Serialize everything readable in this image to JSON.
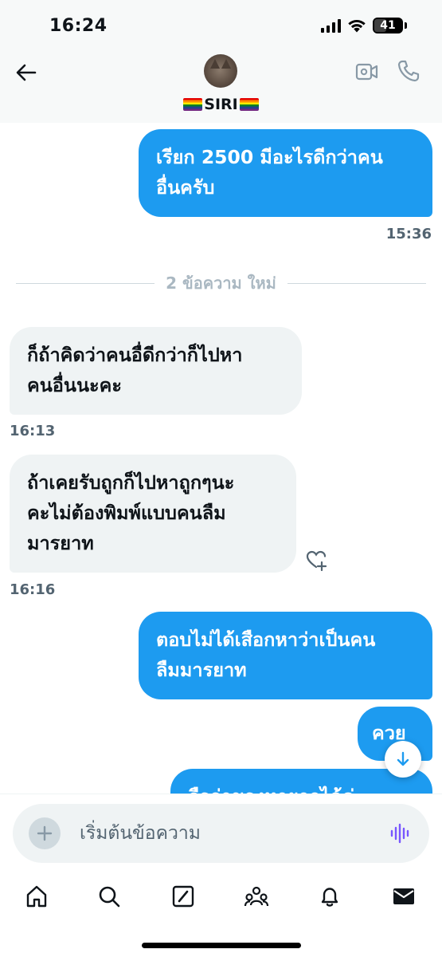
{
  "status_bar": {
    "time": "16:24",
    "battery": "41"
  },
  "header": {
    "contact_name": "SIRI",
    "icons": {
      "back": "arrow-left-icon",
      "video": "video-camera-icon",
      "call": "phone-icon"
    }
  },
  "messages": [
    {
      "direction": "sent",
      "text_lines": [
        "เรียก 2500 มีอะไรดีกว่าคน",
        "อื่นครับ"
      ],
      "time": "15:36"
    },
    {
      "direction": "recv",
      "text_lines": [
        "ก็ถ้าคิดว่าคนอื่ดีกว่าก็ไปหา",
        "คนอื่นนะคะ"
      ],
      "time": "16:13"
    },
    {
      "direction": "recv",
      "text_lines": [
        "ถ้าเคยรับถูกก็ไปหาถูกๆนะ",
        "คะไม่ต้องพิมพ์แบบคนลืม",
        "มารยาท"
      ],
      "time": "16:16"
    },
    {
      "direction": "sent",
      "text_lines": [
        "ตอบไม่ได้เสือกหาว่าเป็นคน",
        "ลืมมารยาท"
      ]
    },
    {
      "direction": "sent",
      "text_lines": [
        "ควย"
      ]
    },
    {
      "direction": "sent",
      "text_lines": [
        "ถือว่าของหายากได้ค่ะ"
      ]
    }
  ],
  "divider": {
    "text": "2 ข้อความ ใหม่"
  },
  "composer": {
    "placeholder": "เริ่มต้นข้อความ"
  },
  "colors": {
    "sent_bubble": "#1d9bf0",
    "recv_bubble": "#eff3f4",
    "timestamp": "#536471",
    "voice_icon": "#7856ff"
  },
  "tabbar": {
    "tabs": [
      "home-icon",
      "search-icon",
      "grok-icon",
      "communities-icon",
      "notifications-icon",
      "messages-icon"
    ],
    "active": "messages-icon"
  }
}
